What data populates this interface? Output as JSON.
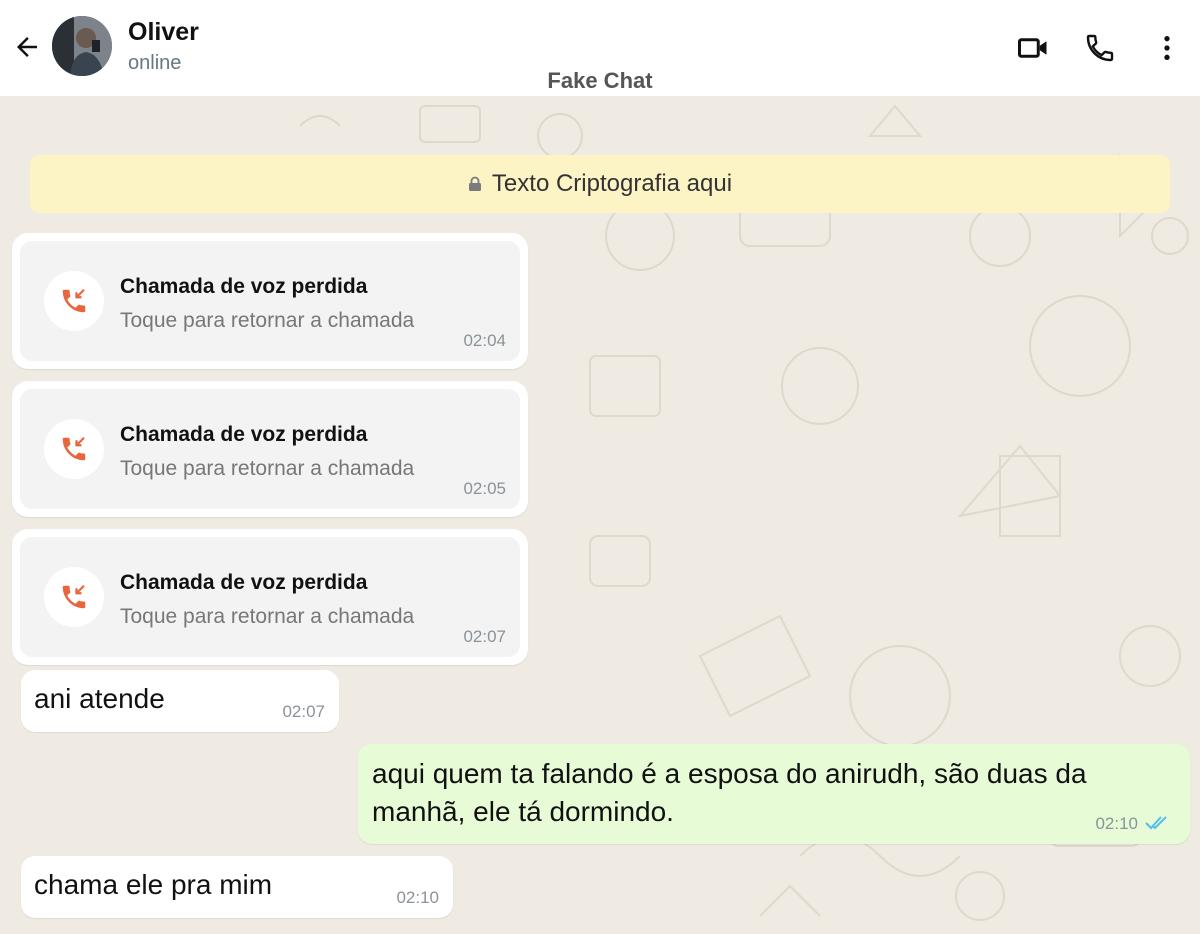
{
  "header": {
    "contact_name": "Oliver",
    "status": "online",
    "app_title": "Fake Chat",
    "icons": [
      "back-arrow-icon",
      "video-call-icon",
      "voice-call-icon",
      "more-options-icon"
    ]
  },
  "chat": {
    "encryption_banner": "Texto Criptografia aqui",
    "missed_calls": [
      {
        "title": "Chamada de voz perdida",
        "subtitle": "Toque para retornar a chamada",
        "time": "02:04"
      },
      {
        "title": "Chamada de voz perdida",
        "subtitle": "Toque para retornar a chamada",
        "time": "02:05"
      },
      {
        "title": "Chamada de voz perdida",
        "subtitle": "Toque para retornar a chamada",
        "time": "02:07"
      }
    ],
    "messages": [
      {
        "direction": "in",
        "text": "ani atende",
        "time": "02:07"
      },
      {
        "direction": "out",
        "line1": "aqui quem ta falando é a esposa do anirudh, são duas da",
        "line2": "manhã, ele tá dormindo.",
        "time": "02:10",
        "status": "read"
      },
      {
        "direction": "in",
        "text": "chama ele pra mim",
        "time": "02:10"
      }
    ]
  },
  "colors": {
    "chat_background": "#efeae2",
    "banner_background": "#fcf4c5",
    "outgoing_bubble": "#e7fcd6",
    "missed_call_icon": "#e8663d",
    "read_ticks": "#53bdeb"
  }
}
